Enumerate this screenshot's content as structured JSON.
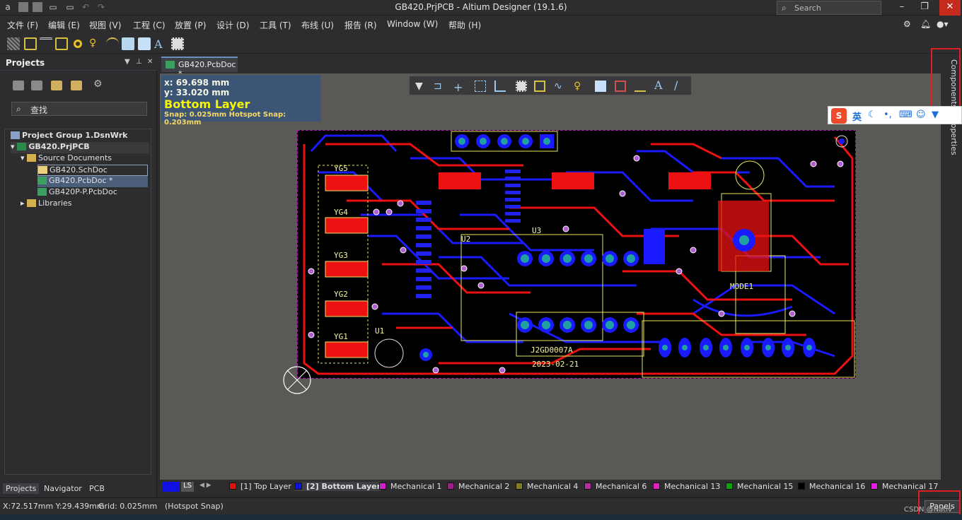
{
  "app": {
    "title": "GB420.PrjPCB - Altium Designer (19.1.6)",
    "search_placeholder": "Search"
  },
  "menu": [
    "文件 (F)",
    "编辑 (E)",
    "视图 (V)",
    "工程 (C)",
    "放置 (P)",
    "设计 (D)",
    "工具 (T)",
    "布线 (U)",
    "报告 (R)",
    "Window (W)",
    "帮助 (H)"
  ],
  "projects_panel": {
    "title": "Projects",
    "search_placeholder": "查找",
    "tree": [
      {
        "label": "Project Group 1.DsnWrk",
        "level": 0
      },
      {
        "label": "GB420.PrjPCB",
        "level": 1
      },
      {
        "label": "Source Documents",
        "level": 2
      },
      {
        "label": "GB420.SchDoc",
        "level": 3
      },
      {
        "label": "GB420.PcbDoc *",
        "level": 3
      },
      {
        "label": "GB420P-P.PcbDoc",
        "level": 3
      },
      {
        "label": "Libraries",
        "level": 2
      }
    ],
    "tabs": [
      "Projects",
      "Navigator",
      "PCB"
    ]
  },
  "document_tab": "GB420.PcbDoc *",
  "coord_overlay": {
    "x": "x: 69.698 mm",
    "y": "y: 33.020 mm",
    "layer": "Bottom Layer",
    "snap": "Snap: 0.025mm Hotspot Snap: 0.203mm"
  },
  "pcb_labels": {
    "yg5": "YG5",
    "yg4": "YG4",
    "yg3": "YG3",
    "yg2": "YG2",
    "yg1": "YG1",
    "u2": "U2",
    "u3": "U3",
    "u1": "U1",
    "mode1": "MODE1",
    "code": "J2GD0007A",
    "date": "2023-02-21"
  },
  "right_panel": {
    "components": "Components",
    "properties": "Properties"
  },
  "ime": {
    "eng": "英"
  },
  "layer_tabs": {
    "ls": "LS",
    "layers": [
      {
        "label": "[1] Top Layer",
        "color": "#e01010"
      },
      {
        "label": "[2] Bottom Layer",
        "color": "#1010e0"
      },
      {
        "label": "Mechanical 1",
        "color": "#d020d0"
      },
      {
        "label": "Mechanical 2",
        "color": "#a0208a"
      },
      {
        "label": "Mechanical 4",
        "color": "#808020"
      },
      {
        "label": "Mechanical 6",
        "color": "#b030a0"
      },
      {
        "label": "Mechanical 13",
        "color": "#e020c0"
      },
      {
        "label": "Mechanical 15",
        "color": "#10a010"
      },
      {
        "label": "Mechanical 16",
        "color": "#000000"
      },
      {
        "label": "Mechanical 17",
        "color": "#e020e0"
      }
    ]
  },
  "status": {
    "xy": "X:72.517mm Y:29.439mm",
    "grid": "Grid: 0.025mm",
    "snap": "(Hotspot Snap)",
    "panels": "Panels",
    "watermark": "CSDN @Nativ"
  }
}
